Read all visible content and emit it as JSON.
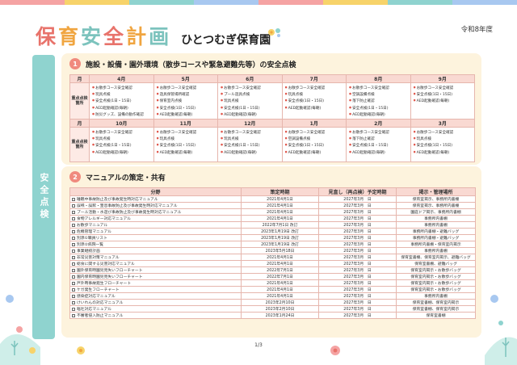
{
  "colors": {
    "stripe": [
      "#f5a3a3",
      "#f7d36a",
      "#8fd3cf",
      "#a8c8f0",
      "#f5a3a3",
      "#f7d36a",
      "#8fd3cf",
      "#a8c8f0"
    ],
    "title": [
      "#e8736b",
      "#f0a540",
      "#7cc3bd",
      "#e8736b",
      "#f0a540",
      "#7cc3bd"
    ],
    "section_num": "#f08a7e",
    "sidebar": "#8fd3cf"
  },
  "header": {
    "title_chars": [
      "保",
      "育",
      "安",
      "全",
      "計",
      "画"
    ],
    "school": "ひとつむぎ保育園",
    "year": "令和8年度"
  },
  "sidebar": {
    "label": "安全点検"
  },
  "section1": {
    "num": "1",
    "title": "施設・設備・園外環境（散歩コースや緊急避難先等）の安全点検",
    "month_label": "月",
    "row_label": "重点点検箇所",
    "months_a": [
      "4月",
      "5月",
      "6月",
      "7月",
      "8月",
      "9月"
    ],
    "months_b": [
      "10月",
      "11月",
      "12月",
      "1月",
      "2月",
      "3月"
    ],
    "cells_a": [
      [
        "お散歩コース安全確認",
        "玩具点検",
        "安全点検(1日・15日)",
        "AED起動確認(毎朝)",
        "防災グッズ、設備の動作確認"
      ],
      [
        "お散歩コース安全確認",
        "遊具保管場所確認",
        "保育室内点検",
        "安全点検(1日・15日)",
        "AED起動確認(毎朝)"
      ],
      [
        "お散歩コース安全確認",
        "プール遊具点検",
        "玩具点検",
        "安全点検(1日・15日)",
        "AED起動確認(毎朝)"
      ],
      [
        "お散歩コース安全確認",
        "玩具点検",
        "安全点検(1日・15日)",
        "AED起動確認(毎朝)"
      ],
      [
        "お散歩コース安全確認",
        "空調設備点検",
        "落下防止確認",
        "安全点検(1日・15日)",
        "AED起動確認(毎朝)"
      ],
      [
        "お散歩コース安全確認",
        "安全点検(1日・15日)",
        "AED起動確認(毎朝)"
      ]
    ],
    "cells_b": [
      [
        "お散歩コース安全確認",
        "玩具点検",
        "安全点検(1日・15日)",
        "AED起動確認(毎朝)"
      ],
      [
        "お散歩コース安全確認",
        "玩具点検",
        "安全点検(1日・15日)",
        "AED起動確認(毎朝)"
      ],
      [
        "お散歩コース安全確認",
        "玩具点検",
        "安全点検(1日・15日)",
        "AED起動確認(毎朝)"
      ],
      [
        "お散歩コース安全確認",
        "空調設備点検",
        "安全点検(1日・15日)",
        "AED起動確認(毎朝)"
      ],
      [
        "お散歩コース安全確認",
        "落下防止確認",
        "安全点検(1日・15日)",
        "AED起動確認(毎朝)"
      ],
      [
        "お散歩コース安全確認",
        "玩具点検",
        "安全点検(1日・15日)",
        "AED起動確認(毎朝)"
      ]
    ]
  },
  "section2": {
    "num": "2",
    "title": "マニュアルの策定・共有",
    "columns": [
      "分野",
      "策定時期",
      "見直し（再点検）予定時期",
      "掲示・管理場所"
    ],
    "rows": [
      [
        "睡眠中事故防止及び事故発生時対応マニュアル",
        "2021年4月1日",
        "2027年3月　日",
        "保育室掲示、事務所内書棚"
      ],
      [
        "誤嚥・誤飲・窒息事故防止及び事故発生時対応マニュアル",
        "2021年4月1日",
        "2027年3月　日",
        "保育室掲示、事務所内書棚"
      ],
      [
        "プール活動・水遊び事故防止及び事故発生時対応マニュアル",
        "2021年4月1日",
        "2027年3月　日",
        "園庭ドア掲示、事務所内書棚"
      ],
      [
        "食物アレルギー対応マニュアル",
        "2021年4月1日",
        "2027年3月　日",
        "事務所内書棚"
      ],
      [
        "お散歩マニュアル",
        "2022年7月1日 改訂",
        "2027年3月　日",
        "事務所内書棚"
      ],
      [
        "危機管理マニュアル",
        "2023年1月19日 改訂",
        "2027年3月　日",
        "事務所内書棚・避難バッグ"
      ],
      [
        "別添①職員リスト",
        "2023年1月19日 改訂",
        "2027年3月　日",
        "事務所内書棚・避難バッグ"
      ],
      [
        "別添②病院一覧",
        "2023年1月19日 改訂",
        "2027年3月　日",
        "事務所内書棚・保育室内掲示"
      ],
      [
        "事業継続計画",
        "2023年5月18日",
        "2027年3月　日",
        "事務所内書棚"
      ],
      [
        "非常災害対策マニュアル",
        "2021年4月1日",
        "2027年3月　日",
        "保育室書棚、保育室内掲示、避難バッグ"
      ],
      [
        "総食に関する災害対応マニュアル",
        "2021年4月1日",
        "2027年3月　日",
        "保育室書棚、避難バッグ"
      ],
      [
        "園外保育時園児見失いフローチャート",
        "2022年7月1日",
        "2027年3月　日",
        "保育室内掲示・お散歩バッグ"
      ],
      [
        "園内保育時園児見失いフローチャート",
        "2022年7月1日",
        "2027年3月　日",
        "保育室内掲示・お散歩バッグ"
      ],
      [
        "戸外時事故発生フローチャート",
        "2021年4月1日",
        "2027年3月　日",
        "保育室内掲示・お散歩バッグ"
      ],
      [
        "ケガ発生フローチャート",
        "2021年4月1日",
        "2027年3月　日",
        "保育室内掲示・お散歩バッグ"
      ],
      [
        "感染症対応マニュアル",
        "2021年4月1日",
        "2027年3月　日",
        "事務所内書棚"
      ],
      [
        "けいれんの対応マニュアル",
        "2023年2月10日",
        "2027年3月　日",
        "保育室書棚、保育室内掲示"
      ],
      [
        "嘔吐対応マニュアル",
        "2023年2月10日",
        "2027年3月　日",
        "保育室書棚、保育室内掲示"
      ],
      [
        "不審者侵入防止マニュアル",
        "2023年1月24日",
        "2027年3月　日",
        "保育室書棚"
      ]
    ]
  },
  "footer": {
    "page": "1/3"
  }
}
